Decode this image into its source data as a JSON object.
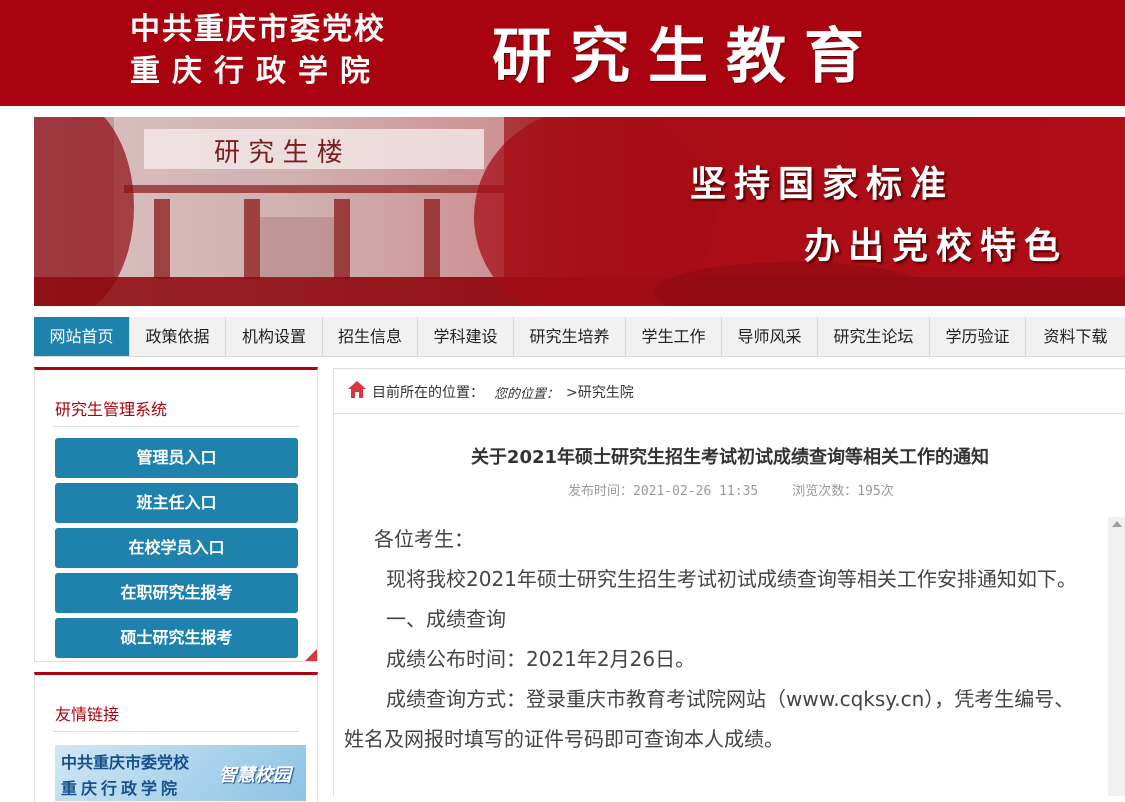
{
  "header": {
    "org_line1": "中共重庆市委党校",
    "org_line2": "重庆行政学院",
    "site_title": "研究生教育"
  },
  "hero": {
    "building_sign": "研 究 生 楼",
    "slogan1": "坚持国家标准",
    "slogan2": "办出党校特色"
  },
  "nav": {
    "items": [
      {
        "label": "网站首页",
        "active": true
      },
      {
        "label": "政策依据"
      },
      {
        "label": "机构设置"
      },
      {
        "label": "招生信息"
      },
      {
        "label": "学科建设"
      },
      {
        "label": "研究生培养"
      },
      {
        "label": "学生工作"
      },
      {
        "label": "导师风采"
      },
      {
        "label": "研究生论坛"
      },
      {
        "label": "学历验证"
      },
      {
        "label": "资料下载"
      }
    ]
  },
  "sidebar": {
    "system_title": "研究生管理系统",
    "buttons": [
      "管理员入口",
      "班主任入口",
      "在校学员入口",
      "在职研究生报考",
      "硕士研究生报考"
    ],
    "links_title": "友情链接",
    "link_banner": {
      "line1": "中共重庆市委党校",
      "line2": "重庆行政学院",
      "tag": "智慧校园"
    }
  },
  "breadcrumb": {
    "label": "目前所在的位置：",
    "you_are_here": "您的位置：",
    "path": ">研究生院"
  },
  "article": {
    "title": "关于2021年硕士研究生招生考试初试成绩查询等相关工作的通知",
    "publish_time": "发布时间：2021-02-26 11:35",
    "views": "浏览次数：195次",
    "paragraphs": [
      "各位考生：",
      "现将我校2021年硕士研究生招生考试初试成绩查询等相关工作安排通知如下。",
      "一、成绩查询",
      "成绩公布时间：2021年2月26日。",
      "成绩查询方式：登录重庆市教育考试院网站（www.cqksy.cn），凭考生编号、姓名及网报时填写的证件号码即可查询本人成绩。"
    ]
  },
  "colors": {
    "brand_red": "#a8030e",
    "nav_active": "#1e82ad"
  }
}
